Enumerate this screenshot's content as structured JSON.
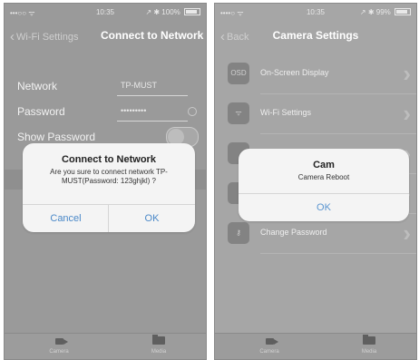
{
  "left": {
    "status": {
      "signal": "•••○○ ᯤ",
      "time": "10:35",
      "right": "↗ ✱ 100%"
    },
    "nav": {
      "back_label": "Wi-Fi Settings",
      "title": "Connect to Network"
    },
    "form": {
      "network_label": "Network",
      "network_value": "TP-MUST",
      "password_label": "Password",
      "password_value": "•••••••••",
      "show_password_label": "Show Password"
    },
    "dialog": {
      "title": "Connect to Network",
      "message": "Are you sure to connect network TP-MUST(Password: 123ghjkl) ?",
      "cancel_label": "Cancel",
      "ok_label": "OK"
    },
    "tabs": {
      "camera_label": "Camera",
      "media_label": "Media"
    }
  },
  "right": {
    "status": {
      "signal": "••••○ ᯤ",
      "time": "10:35",
      "right": "↗ ✱ 99%"
    },
    "nav": {
      "back_label": "Back",
      "title": "Camera Settings"
    },
    "list": [
      {
        "icon_text": "OSD",
        "label": "On-Screen Display"
      },
      {
        "icon_text": "",
        "label": "Wi-Fi Settings"
      },
      {
        "icon_text": "",
        "label": ""
      },
      {
        "icon_text": "",
        "label": ""
      },
      {
        "icon_text": "",
        "label": "Change Password"
      }
    ],
    "dialog": {
      "title": "Cam",
      "message": "Camera Reboot",
      "ok_label": "OK"
    },
    "tabs": {
      "camera_label": "Camera",
      "media_label": "Media"
    }
  },
  "colors": {
    "dialog_button": "#4a88c8",
    "overlay_gray": "#9a9a9a"
  }
}
